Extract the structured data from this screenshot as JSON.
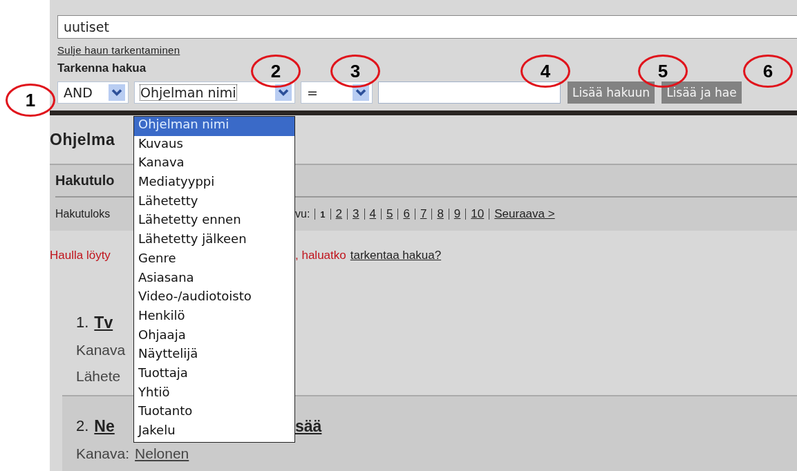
{
  "search": {
    "value": "uutiset"
  },
  "close_refine_link": "Sulje haun tarkentaminen",
  "refine_heading": "Tarkenna hakua",
  "refine_row": {
    "operator": "AND",
    "field": "Ohjelman nimi",
    "comparator": "=",
    "buttons": [
      "Lisää hakuun",
      "Lisää ja hae"
    ]
  },
  "field_dropdown": {
    "options": [
      {
        "label": "Ohjelman nimi",
        "selected": true
      },
      {
        "label": "Kuvaus",
        "selected": false
      },
      {
        "label": "Kanava",
        "selected": false
      },
      {
        "label": "Mediatyyppi",
        "selected": false
      },
      {
        "label": "Lähetetty",
        "selected": false
      },
      {
        "label": "Lähetetty ennen",
        "selected": false
      },
      {
        "label": "Lähetetty jälkeen",
        "selected": false
      },
      {
        "label": "Genre",
        "selected": false
      },
      {
        "label": "Asiasana",
        "selected": false
      },
      {
        "label": "Video-/audiotoisto",
        "selected": false
      },
      {
        "label": "Henkilö",
        "selected": false
      },
      {
        "label": "Ohjaaja",
        "selected": false
      },
      {
        "label": "Näyttelijä",
        "selected": false
      },
      {
        "label": "Tuottaja",
        "selected": false
      },
      {
        "label": "Yhtiö",
        "selected": false
      },
      {
        "label": "Tuotanto",
        "selected": false
      },
      {
        "label": "Jakelu",
        "selected": false
      }
    ]
  },
  "callouts": [
    "1",
    "2",
    "3",
    "4",
    "5",
    "6"
  ],
  "results": {
    "heading_fragment": "Ohjelma",
    "section_title_fragment": "Hakutulo",
    "count_fragment": "Hakutuloks",
    "pagination": {
      "label_fragment": "vu:",
      "pages": [
        {
          "label": "1",
          "selected": true
        },
        {
          "label": "2",
          "selected": false
        },
        {
          "label": "3",
          "selected": false
        },
        {
          "label": "4",
          "selected": false
        },
        {
          "label": "5",
          "selected": false
        },
        {
          "label": "6",
          "selected": false
        },
        {
          "label": "7",
          "selected": false
        },
        {
          "label": "8",
          "selected": false
        },
        {
          "label": "9",
          "selected": false
        },
        {
          "label": "10",
          "selected": false
        }
      ],
      "next": "Seuraava >"
    },
    "notice": {
      "left_fragment": "Haulla löyty",
      "right_fragment": ", haluatko",
      "link": "tarkentaa hakua?"
    },
    "items": [
      {
        "kind": "plain",
        "number": "1.",
        "title_fragment": "Tv",
        "fields": [
          {
            "left_fragment": "Kanava"
          },
          {
            "left_fragment": "Lähete"
          }
        ]
      },
      {
        "kind": "boxed",
        "number": "2.",
        "title_fragment": "Ne",
        "title_tail": "sää",
        "fields": [
          {
            "label": "Kanava:",
            "value": "Nelonen"
          }
        ]
      }
    ]
  }
}
